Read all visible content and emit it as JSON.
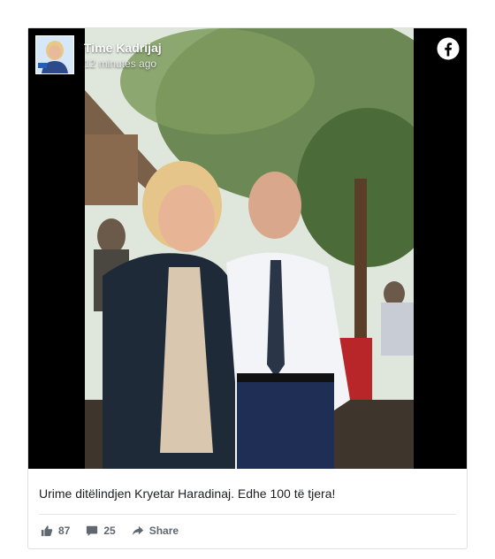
{
  "post": {
    "author": "Time Kadrijaj",
    "timestamp": "12 minutes ago",
    "caption": "Urime ditëlindjen Kryetar Haradinaj. Edhe 100 të tjera!",
    "likes": "87",
    "comments": "25",
    "share_label": "Share"
  },
  "icons": {
    "platform": "facebook-icon",
    "like": "thumbs-up-icon",
    "comment": "comment-bubble-icon",
    "share": "share-arrow-icon"
  },
  "colors": {
    "media_background": "#000000",
    "facebook_icon": "#ffffff",
    "action_text": "#606770",
    "border": "#dddfe2"
  }
}
